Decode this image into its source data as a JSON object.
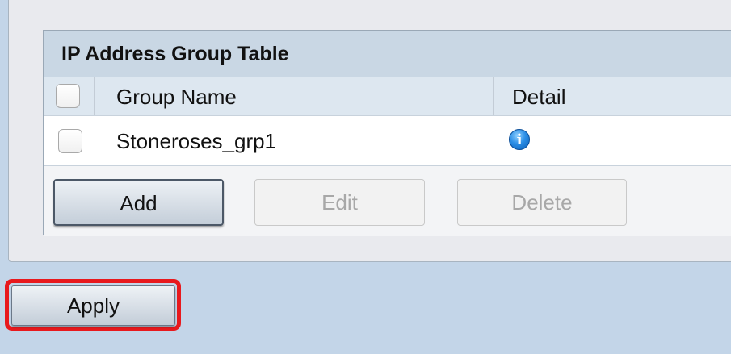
{
  "table": {
    "title": "IP Address Group Table",
    "columns": [
      "Group Name",
      "Detail"
    ],
    "rows": [
      {
        "group_name": "Stoneroses_grp1",
        "detail_icon": "info-icon"
      }
    ]
  },
  "buttons": {
    "add": "Add",
    "edit": "Edit",
    "delete": "Delete",
    "apply": "Apply"
  },
  "colors": {
    "highlight": "#e8191d",
    "page_background": "#c3d5e8"
  }
}
